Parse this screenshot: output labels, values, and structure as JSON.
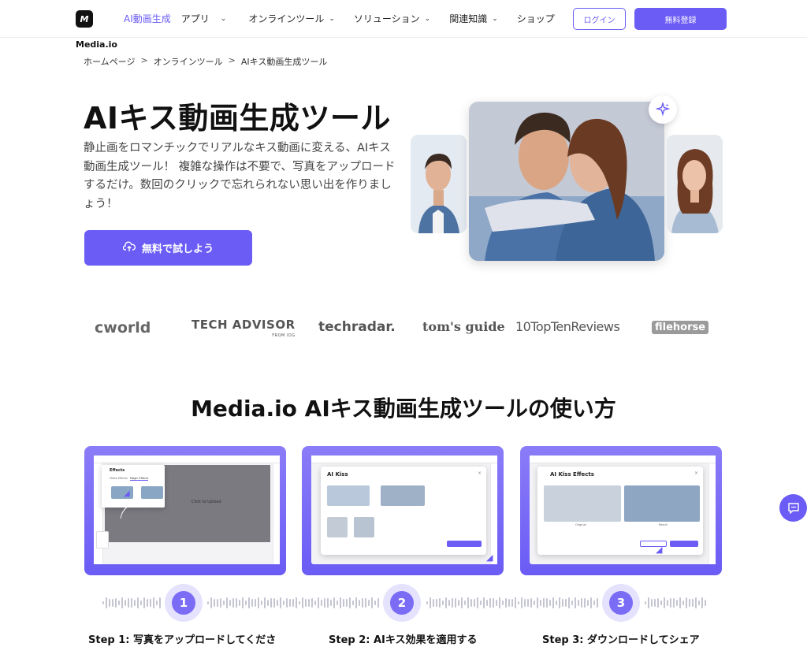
{
  "header": {
    "logo": "M",
    "brand": "Media.io",
    "nav": [
      {
        "label": "AI動画生成",
        "active": true,
        "dropdown": false
      },
      {
        "label": "アプリ",
        "active": false,
        "dropdown": true
      },
      {
        "label": "オンラインツール",
        "active": false,
        "dropdown": true
      },
      {
        "label": "ソリューション",
        "active": false,
        "dropdown": true
      },
      {
        "label": "関連知識",
        "active": false,
        "dropdown": true
      },
      {
        "label": "ショップ",
        "active": false,
        "dropdown": false
      }
    ],
    "login": "ログイン",
    "signup": "無料登録"
  },
  "breadcrumb": [
    "ホームページ",
    "オンラインツール",
    "AIキス動画生成ツール"
  ],
  "hero": {
    "title": "AIキス動画生成ツール",
    "description": "静止画をロマンチックでリアルなキス動画に変える、AIキス動画生成ツール！ 複雑な操作は不要で、写真をアップロードするだけ。数回のクリックで忘れられない思い出を作りましょう！",
    "cta": "無料で試しよう"
  },
  "press": [
    "cworld",
    "TECH ADVISOR",
    "FROM IDG",
    "techradar.",
    "tom's guide",
    "10TopTenReviews",
    "filehorse"
  ],
  "how_to": {
    "title": "Media.io AIキス動画生成ツールの使い方",
    "steps": [
      {
        "num": "1",
        "label": "Step 1: 写真をアップロードしてくださ"
      },
      {
        "num": "2",
        "label": "Step 2: AIキス効果を適用する"
      },
      {
        "num": "3",
        "label": "Step 3: ダウンロードしてシェア"
      }
    ],
    "card1": {
      "panel_title": "Effects",
      "tab1": "Video Effects",
      "tab2": "Magic Effects",
      "upload": "Click to Upload"
    },
    "card2": {
      "panel_title": "AI Kiss"
    },
    "card3": {
      "panel_title": "AI Kiss Effects",
      "left": "Original",
      "right": "Result"
    }
  },
  "colors": {
    "accent": "#6a5cf5"
  }
}
